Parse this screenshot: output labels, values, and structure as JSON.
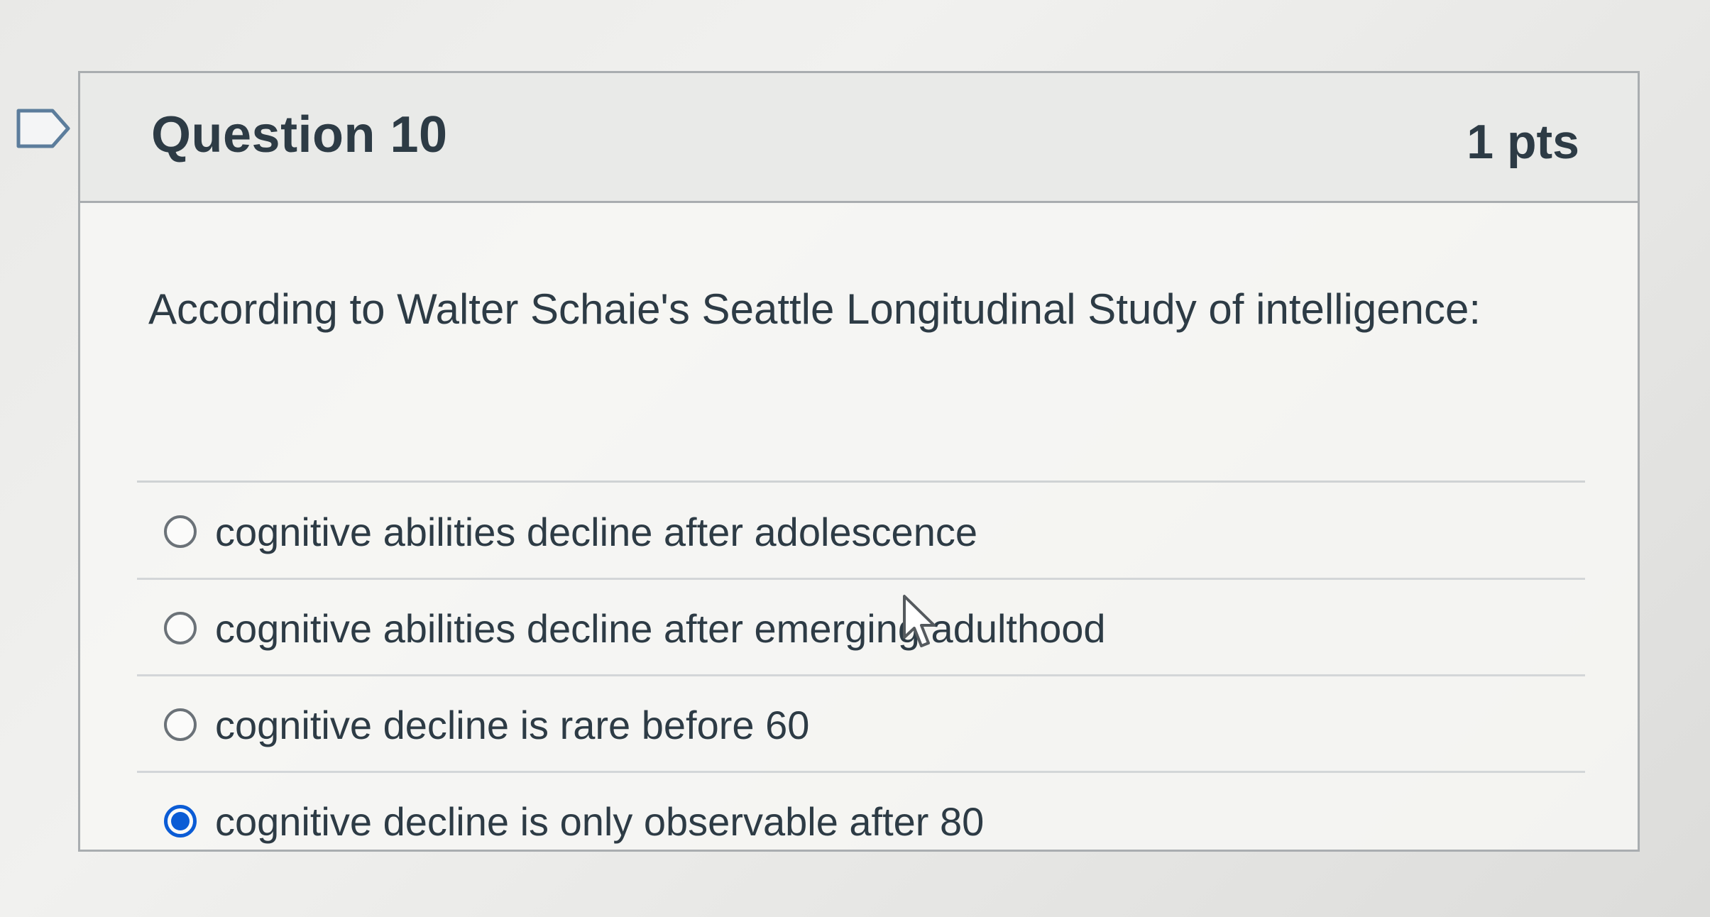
{
  "question": {
    "title": "Question 10",
    "points": "1 pts",
    "text": "According to Walter Schaie's Seattle Longitudinal Study of intelligence:",
    "answers": [
      {
        "label": "cognitive abilities decline after adolescence",
        "selected": false
      },
      {
        "label": "cognitive abilities decline after emerging adulthood",
        "selected": false
      },
      {
        "label": "cognitive decline is rare before 60",
        "selected": false
      },
      {
        "label": "cognitive decline is only observable after 80",
        "selected": true
      }
    ]
  },
  "colors": {
    "accent": "#0b5cd5",
    "text": "#2d3b45",
    "border": "#a9adb0"
  },
  "icons": {
    "flag": "flag-icon",
    "cursor": "mouse-cursor-icon"
  }
}
